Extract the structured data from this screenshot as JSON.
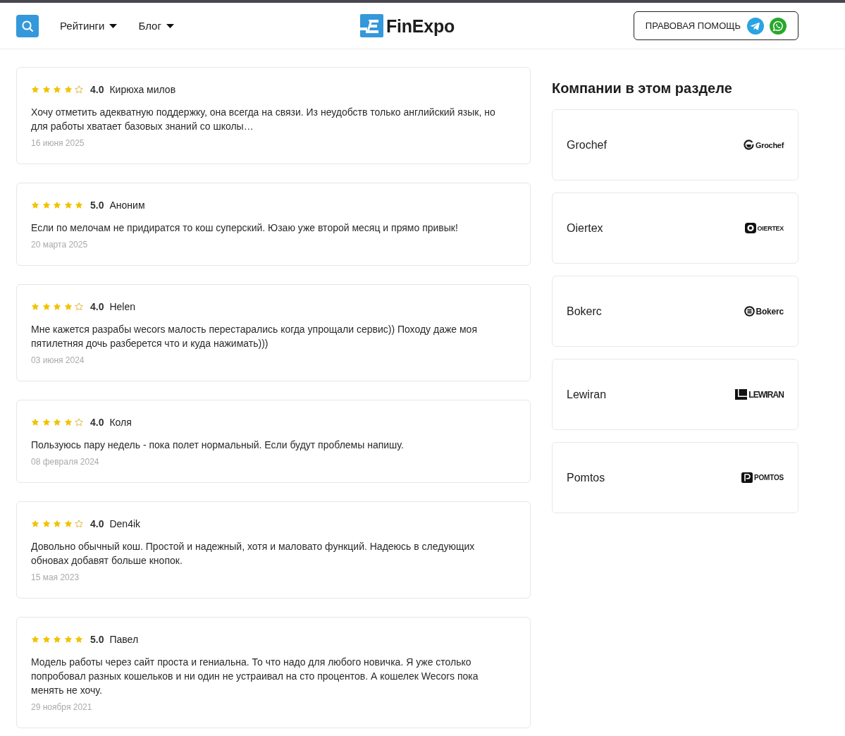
{
  "header": {
    "nav": [
      {
        "label": "Рейтинги"
      },
      {
        "label": "Блог"
      }
    ],
    "logo": "FinExpo",
    "legal_button": "ПРАВОВАЯ ПОМОЩЬ"
  },
  "reviews": [
    {
      "stars": 4,
      "rating": "4.0",
      "author": "Кирюха милов",
      "text": "Хочу отметить адекватную поддержку, она всегда на связи. Из неудобств только английский язык, но для работы хватает базовых знаний со школы…",
      "date": "16 июня 2025"
    },
    {
      "stars": 5,
      "rating": "5.0",
      "author": "Аноним",
      "text": "Если по мелочам не придиратся то кош суперский. Юзаю уже второй месяц и прямо привык!",
      "date": "20 марта 2025"
    },
    {
      "stars": 4,
      "rating": "4.0",
      "author": "Helen",
      "text": "Мне кажется разрабы wecors малость перестарались когда упрощали сервис)) Походу даже моя пятилетняя дочь разберется что и куда нажимать)))",
      "date": "03 июня 2024"
    },
    {
      "stars": 4,
      "rating": "4.0",
      "author": "Коля",
      "text": "Пользуюсь пару недель - пока полет нормальный. Если будут проблемы напишу.",
      "date": "08 февраля 2024"
    },
    {
      "stars": 4,
      "rating": "4.0",
      "author": "Den4ik",
      "text": "Довольно обычный кош. Простой и надежный, хотя и маловато функций. Надеюсь в следующих обновах добавят больше кнопок.",
      "date": "15 мая 2023"
    },
    {
      "stars": 5,
      "rating": "5.0",
      "author": "Павел",
      "text": "Модель работы через сайт проста и гениальна. То что надо для любого новичка. Я уже столько попробовал разных кошельков и ни один не устраивал на сто процентов. А кошелек Wecors пока менять не хочу.",
      "date": "29 ноября 2021"
    }
  ],
  "sidebar": {
    "title": "Компании в этом разделе",
    "companies": [
      {
        "name": "Grochef",
        "logo": {
          "kind": "ring",
          "text": "Grochef"
        }
      },
      {
        "name": "Oiertex",
        "logo": {
          "kind": "dot",
          "text": "OIERTEX"
        }
      },
      {
        "name": "Bokerc",
        "logo": {
          "kind": "bars",
          "text": "Bokerc"
        }
      },
      {
        "name": "Lewiran",
        "logo": {
          "kind": "block",
          "text": "LEWIRAN"
        }
      },
      {
        "name": "Pomtos",
        "logo": {
          "kind": "tile",
          "text": "POMTOS"
        }
      }
    ]
  }
}
